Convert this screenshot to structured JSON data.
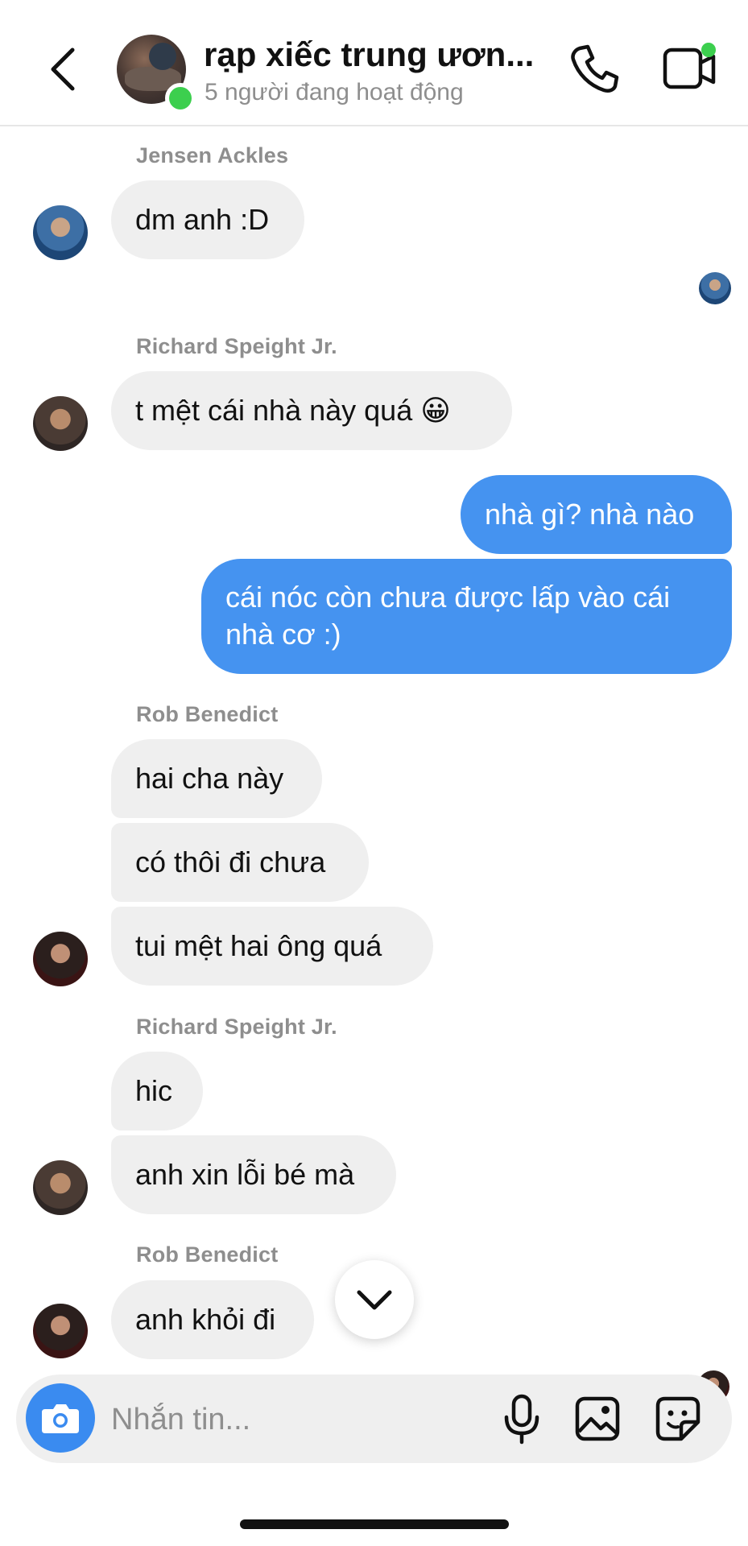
{
  "header": {
    "title": "rạp xiếc trung ươn...",
    "subtitle": "5 người đang hoạt động",
    "back_icon": "chevron-left-icon",
    "call_icon": "phone-icon",
    "video_icon": "video-camera-icon"
  },
  "messages": [
    {
      "sender": "Jensen Ackles",
      "text": "dm anh :D",
      "direction": "in"
    },
    {
      "sender": "Richard Speight Jr.",
      "text": "t mệt cái nhà này quá 😀",
      "direction": "in"
    },
    {
      "text": "nhà gì? nhà nào",
      "direction": "out"
    },
    {
      "text_line1": "cái nóc còn chưa được lấp vào cái",
      "text_line2": "nhà cơ :)",
      "direction": "out"
    },
    {
      "sender": "Rob Benedict",
      "texts": [
        "hai cha này",
        "có thôi đi chưa",
        "tui mệt hai ông quá"
      ],
      "direction": "in"
    },
    {
      "sender": "Richard Speight Jr.",
      "texts": [
        "hic",
        "anh xin lỗi bé mà"
      ],
      "direction": "in"
    },
    {
      "sender": "Rob Benedict",
      "text": "anh khỏi đi",
      "direction": "in"
    }
  ],
  "composer": {
    "placeholder": "Nhắn tin...",
    "camera_icon": "camera-icon",
    "mic_icon": "microphone-icon",
    "gallery_icon": "image-icon",
    "sticker_icon": "sticker-icon"
  },
  "colors": {
    "outgoing_bubble": "#4593f0",
    "incoming_bubble": "#efefef",
    "online": "#3ccf4e",
    "camera_button": "#3a8bf0"
  }
}
